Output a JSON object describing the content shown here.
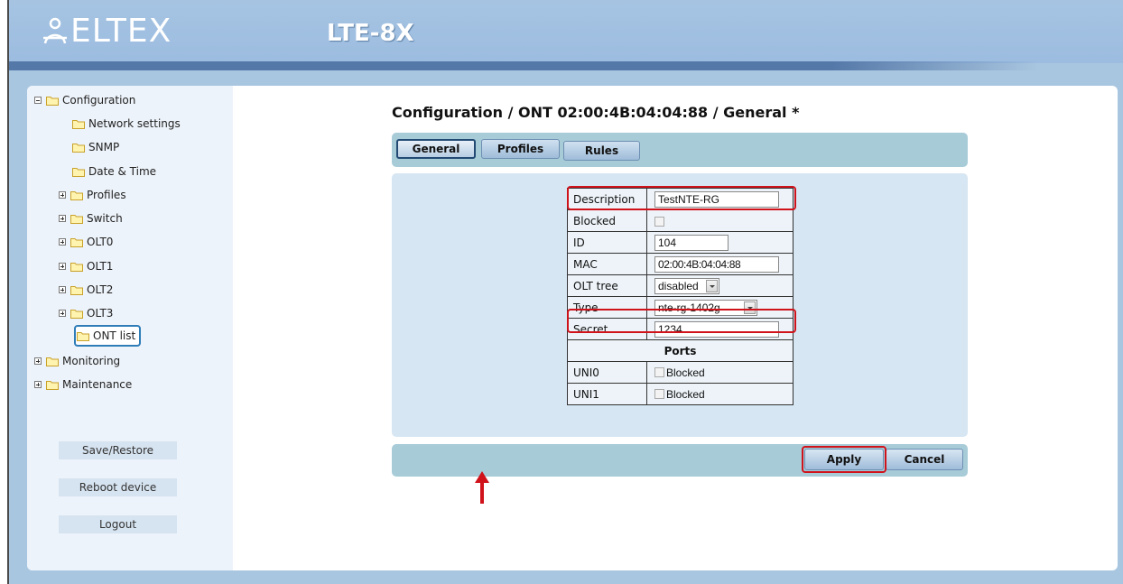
{
  "header": {
    "brand": "ELTEX",
    "model": "LTE-8X"
  },
  "sidebar": {
    "tree": [
      {
        "label": "Configuration",
        "expander": "minus"
      },
      {
        "label": "Network settings"
      },
      {
        "label": "SNMP"
      },
      {
        "label": "Date & Time"
      },
      {
        "label": "Profiles",
        "expander": "plus"
      },
      {
        "label": "Switch",
        "expander": "plus"
      },
      {
        "label": "OLT0",
        "expander": "plus"
      },
      {
        "label": "OLT1",
        "expander": "plus"
      },
      {
        "label": "OLT2",
        "expander": "plus"
      },
      {
        "label": "OLT3",
        "expander": "plus"
      },
      {
        "label": "ONT list",
        "selected": true
      },
      {
        "label": "Monitoring",
        "expander": "plus"
      },
      {
        "label": "Maintenance",
        "expander": "plus"
      }
    ],
    "buttons": {
      "save_restore": "Save/Restore",
      "reboot": "Reboot device",
      "logout": "Logout"
    }
  },
  "main": {
    "title": "Configuration / ONT 02:00:4B:04:04:88 / General *",
    "tabs": [
      {
        "label": "General",
        "active": true
      },
      {
        "label": "Profiles"
      },
      {
        "label": "Rules"
      }
    ],
    "form": {
      "description": {
        "label": "Description",
        "value": "TestNTE-RG"
      },
      "blocked": {
        "label": "Blocked",
        "checked": false
      },
      "id": {
        "label": "ID",
        "value": "104"
      },
      "mac": {
        "label": "MAC",
        "value": "02:00:4B:04:04:88"
      },
      "olt_tree": {
        "label": "OLT tree",
        "value": "disabled"
      },
      "type": {
        "label": "Type",
        "value": "nte-rg-1402g"
      },
      "secret": {
        "label": "Secret",
        "value": "1234"
      },
      "ports_header": "Ports",
      "ports": [
        {
          "label": "UNI0",
          "checkbox_label": "Blocked",
          "checked": false
        },
        {
          "label": "UNI1",
          "checkbox_label": "Blocked",
          "checked": false
        }
      ]
    },
    "actions": {
      "apply": "Apply",
      "cancel": "Cancel"
    }
  },
  "colors": {
    "header_bg": "#a6c4e2",
    "highlight": "#d0121b",
    "tab_bar": "#a7ccd8",
    "form_bg": "#d6e6f2"
  }
}
